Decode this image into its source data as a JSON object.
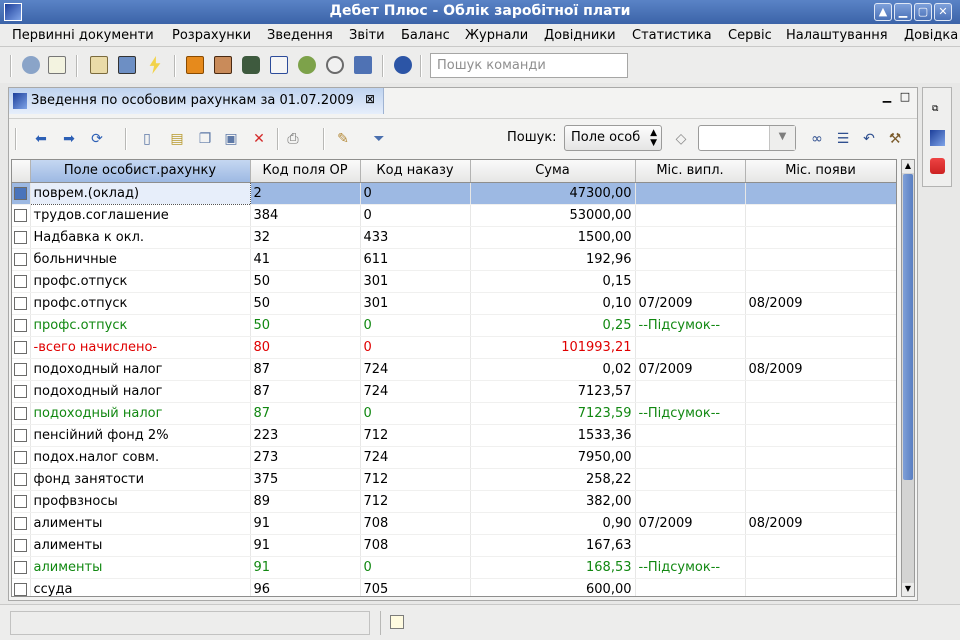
{
  "window": {
    "title": "Дебет Плюс - Облік заробітної плати",
    "buttons": [
      "▲",
      "▁",
      "▢",
      "✕"
    ]
  },
  "menu": [
    "Первинні документи",
    "Розрахунки",
    "Зведення",
    "Звіти",
    "Баланс",
    "Журнали",
    "Довідники",
    "Статистика",
    "Сервіс",
    "Налаштування",
    "Довідка"
  ],
  "toolbar": {
    "command_placeholder": "Пошук команди",
    "icons": [
      "db-icon",
      "notes-icon",
      "card-icon",
      "monitor-icon",
      "lightning-icon",
      "orange-box-icon",
      "portrait-icon",
      "camera-icon",
      "calendar-icon",
      "person-add-icon",
      "magnifier-icon",
      "tools-icon",
      "help-icon"
    ]
  },
  "view": {
    "tab_label": "Зведення по особовим рахункам за 01.07.2009",
    "search_label": "Пошук:",
    "search_field": "Поле особ",
    "search_value": ""
  },
  "grid": {
    "columns": [
      "Поле особист.рахунку",
      "Код поля ОР",
      "Код наказу",
      "Сума",
      "Міс. випл.",
      "Міс. появи"
    ],
    "rows": [
      {
        "name": "поврем.(оклад)",
        "code": "2",
        "order": "0",
        "sum": "47300,00",
        "paid": "",
        "appeared": "",
        "style": "selected"
      },
      {
        "name": "трудов.соглашение",
        "code": "384",
        "order": "0",
        "sum": "53000,00",
        "paid": "",
        "appeared": "",
        "style": ""
      },
      {
        "name": " Надбавка к окл.",
        "code": "32",
        "order": "433",
        "sum": "1500,00",
        "paid": "",
        "appeared": "",
        "style": ""
      },
      {
        "name": " больничные",
        "code": "41",
        "order": "611",
        "sum": "192,96",
        "paid": "",
        "appeared": "",
        "style": ""
      },
      {
        "name": " профс.отпуск",
        "code": "50",
        "order": "301",
        "sum": "0,15",
        "paid": "",
        "appeared": "",
        "style": ""
      },
      {
        "name": " профс.отпуск",
        "code": "50",
        "order": "301",
        "sum": "0,10",
        "paid": "07/2009",
        "appeared": "08/2009",
        "style": ""
      },
      {
        "name": " профс.отпуск",
        "code": "50",
        "order": "0",
        "sum": "0,25",
        "paid": "--Підсумок--",
        "appeared": "",
        "style": "green"
      },
      {
        "name": "-всего начислено-",
        "code": "80",
        "order": "0",
        "sum": "101993,21",
        "paid": "",
        "appeared": "",
        "style": "red"
      },
      {
        "name": " подоходный налог",
        "code": "87",
        "order": "724",
        "sum": "0,02",
        "paid": "07/2009",
        "appeared": "08/2009",
        "style": ""
      },
      {
        "name": " подоходный налог",
        "code": "87",
        "order": "724",
        "sum": "7123,57",
        "paid": "",
        "appeared": "",
        "style": ""
      },
      {
        "name": " подоходный налог",
        "code": "87",
        "order": "0",
        "sum": "7123,59",
        "paid": "--Підсумок--",
        "appeared": "",
        "style": "green"
      },
      {
        "name": "пенсійний фонд 2%",
        "code": "223",
        "order": "712",
        "sum": "1533,36",
        "paid": "",
        "appeared": "",
        "style": ""
      },
      {
        "name": "подох.налог совм.",
        "code": "273",
        "order": "724",
        "sum": "7950,00",
        "paid": "",
        "appeared": "",
        "style": ""
      },
      {
        "name": " фонд занятости",
        "code": "375",
        "order": "712",
        "sum": "258,22",
        "paid": "",
        "appeared": "",
        "style": ""
      },
      {
        "name": " профвзносы",
        "code": "89",
        "order": "712",
        "sum": "382,00",
        "paid": "",
        "appeared": "",
        "style": ""
      },
      {
        "name": " алименты",
        "code": "91",
        "order": "708",
        "sum": "0,90",
        "paid": "07/2009",
        "appeared": "08/2009",
        "style": ""
      },
      {
        "name": " алименты",
        "code": "91",
        "order": "708",
        "sum": "167,63",
        "paid": "",
        "appeared": "",
        "style": ""
      },
      {
        "name": " алименты",
        "code": "91",
        "order": "0",
        "sum": "168,53",
        "paid": "--Підсумок--",
        "appeared": "",
        "style": "green"
      },
      {
        "name": " ссуда",
        "code": "96",
        "order": "705",
        "sum": "600,00",
        "paid": "",
        "appeared": "",
        "style": ""
      }
    ]
  },
  "colors": {
    "title": "#3b63a8",
    "selection": "#9db9e3",
    "green": "#118811",
    "red": "#e00000"
  }
}
